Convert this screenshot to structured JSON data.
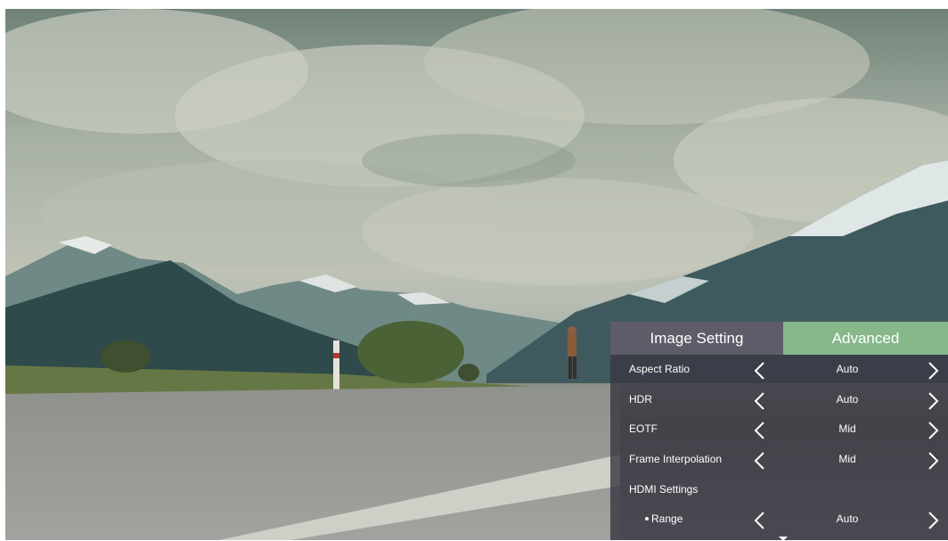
{
  "tabs": {
    "left_label": "Image Setting",
    "right_label": "Advanced"
  },
  "menu": {
    "items": [
      {
        "label": "Aspect Ratio",
        "value": "Auto"
      },
      {
        "label": "HDR",
        "value": "Auto"
      },
      {
        "label": "EOTF",
        "value": "Mid"
      },
      {
        "label": "Frame Interpolation",
        "value": "Mid"
      },
      {
        "label": "HDMI Settings"
      },
      {
        "label": "Range",
        "value": "Auto"
      }
    ]
  },
  "icons": {
    "prev": "chevron-left-icon",
    "next": "chevron-right-icon",
    "scroll": "caret-down-icon"
  },
  "colors": {
    "active_tab": "#86b88a",
    "panel": "#3a3844"
  }
}
